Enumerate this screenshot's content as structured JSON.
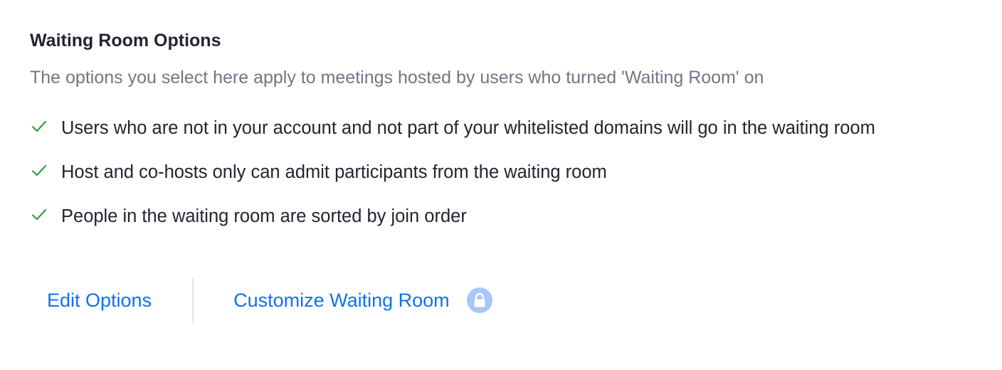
{
  "waiting_room": {
    "title": "Waiting Room Options",
    "description": "The options you select here apply to meetings hosted by users who turned 'Waiting Room' on",
    "options": [
      {
        "icon": "check-icon",
        "text": "Users who are not in your account and not part of your whitelisted domains will go in the waiting room"
      },
      {
        "icon": "check-icon",
        "text": "Host and co-hosts only can admit participants from the waiting room"
      },
      {
        "icon": "check-icon",
        "text": "People in the waiting room are sorted by join order"
      }
    ],
    "actions": {
      "edit_label": "Edit Options",
      "customize_label": "Customize Waiting Room",
      "customize_icon": "lock-icon"
    }
  },
  "colors": {
    "title": "#232333",
    "description": "#747487",
    "check": "#2f9e44",
    "link": "#0e72ed",
    "lock_badge": "#a9c6f7",
    "divider": "#e4e4e9"
  }
}
